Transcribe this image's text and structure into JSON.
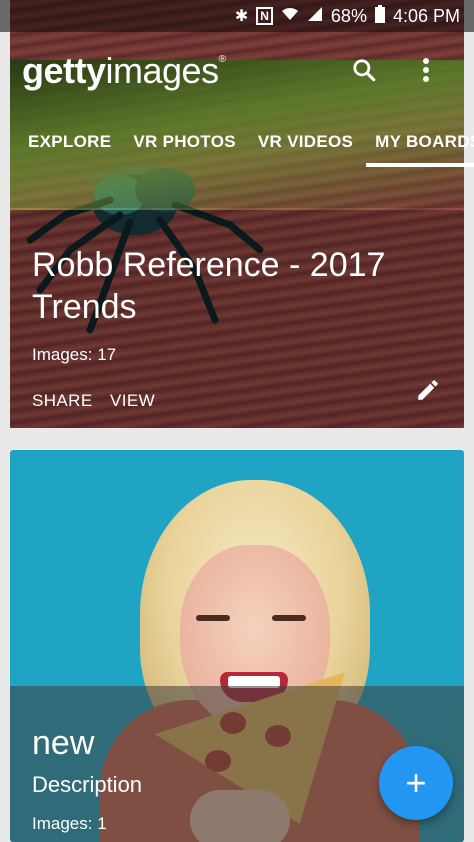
{
  "status_bar": {
    "icons": [
      "bluetooth-icon",
      "nfc-icon",
      "wifi-icon",
      "signal-icon"
    ],
    "battery": "68%",
    "time": "4:06 PM"
  },
  "header": {
    "logo_bold": "getty",
    "logo_light": "images",
    "logo_mark": "®",
    "search_icon": "search-icon",
    "menu_icon": "more-vert-icon"
  },
  "tabs": [
    {
      "label": "EXPLORE",
      "active": false
    },
    {
      "label": "VR PHOTOS",
      "active": false
    },
    {
      "label": "VR VIDEOS",
      "active": false
    },
    {
      "label": "MY BOARDS",
      "active": true
    }
  ],
  "boards": [
    {
      "title_line1": "Robb Reference - 2017",
      "title_line2": "Trends",
      "images": "Images: 17",
      "share": "SHARE",
      "view": "VIEW",
      "edit_icon": "pencil-icon"
    },
    {
      "title": "new",
      "description": "Description",
      "images": "Images: 1"
    }
  ],
  "fab": {
    "label": "+",
    "icon": "plus-icon",
    "color": "#2196f3"
  }
}
